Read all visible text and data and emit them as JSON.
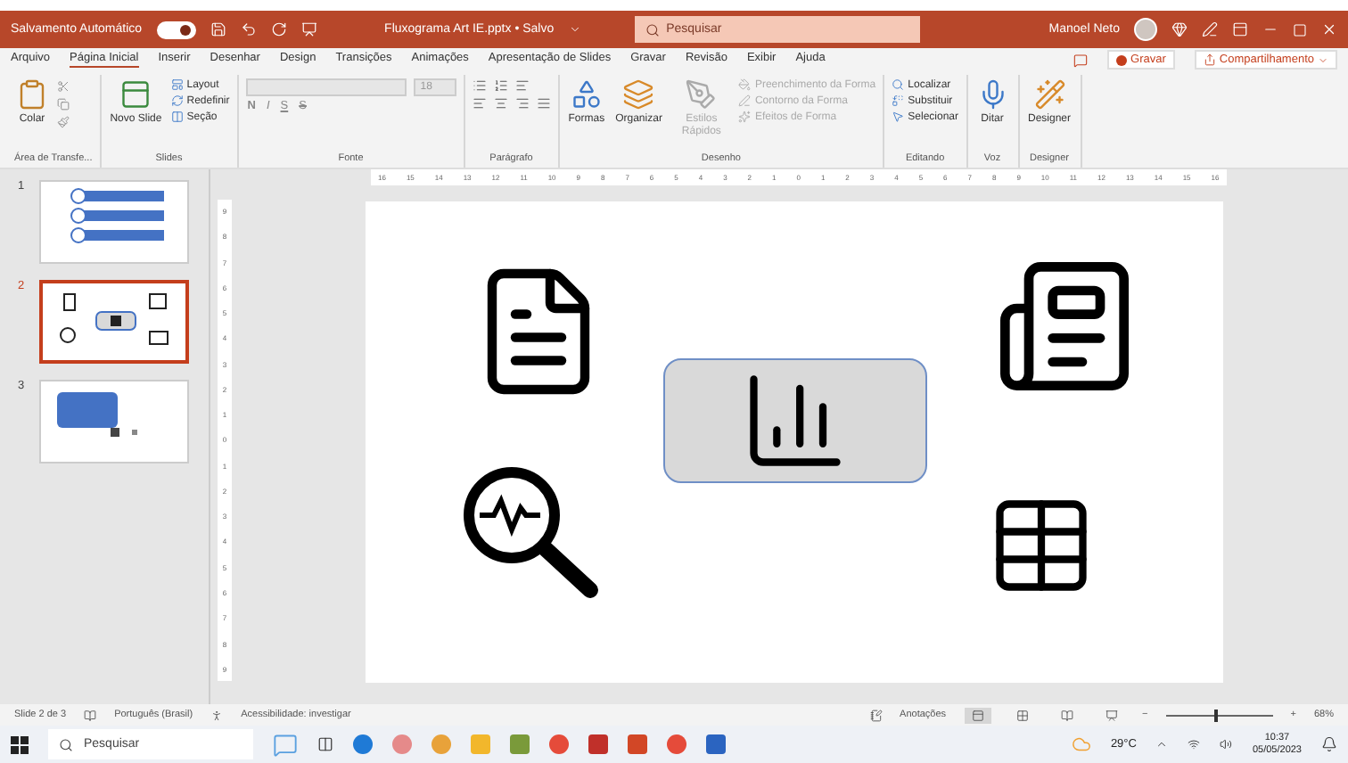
{
  "title_bar": {
    "autosave_label": "Salvamento Automático",
    "autosave_on": true,
    "file_title": "Fluxograma Art IE.pptx • Salvo",
    "search_placeholder": "Pesquisar",
    "user_name": "Manoel Neto"
  },
  "menu_tabs": [
    {
      "label": "Arquivo",
      "selected": false
    },
    {
      "label": "Página Inicial",
      "selected": true
    },
    {
      "label": "Inserir",
      "selected": false
    },
    {
      "label": "Desenhar",
      "selected": false
    },
    {
      "label": "Design",
      "selected": false
    },
    {
      "label": "Transições",
      "selected": false
    },
    {
      "label": "Animações",
      "selected": false
    },
    {
      "label": "Apresentação de Slides",
      "selected": false
    },
    {
      "label": "Gravar",
      "selected": false
    },
    {
      "label": "Revisão",
      "selected": false
    },
    {
      "label": "Exibir",
      "selected": false
    },
    {
      "label": "Ajuda",
      "selected": false
    }
  ],
  "record_button": "Gravar",
  "share_button": "Compartilhamento",
  "ribbon_groups": [
    {
      "title": "Área de Transfe...",
      "items": [
        {
          "kind": "big",
          "label": "Colar",
          "disabled": false
        },
        {
          "kind": "icons"
        }
      ]
    },
    {
      "title": "Slides",
      "items": [
        {
          "kind": "big",
          "label": "Novo Slide",
          "disabled": false
        },
        {
          "kind": "small",
          "labels": [
            "Layout",
            "Redefinir",
            "Seção"
          ],
          "disabled": false
        }
      ]
    },
    {
      "title": "Fonte",
      "items": [
        {
          "kind": "font",
          "size": "18",
          "format_buttons": [
            "N",
            "I",
            "S",
            "S"
          ]
        }
      ]
    },
    {
      "title": "Parágrafo",
      "items": [
        {
          "kind": "paragraph"
        }
      ]
    },
    {
      "title": "Desenho",
      "items": [
        {
          "kind": "big",
          "label": "Formas",
          "disabled": false
        },
        {
          "kind": "big",
          "label": "Organizar",
          "disabled": false
        },
        {
          "kind": "big",
          "label": "Estilos Rápidos",
          "disabled": true
        },
        {
          "kind": "small",
          "labels": [
            "Preenchimento da Forma",
            "Contorno da Forma",
            "Efeitos de Forma"
          ],
          "disabled": true
        }
      ]
    },
    {
      "title": "Editando",
      "items": [
        {
          "kind": "small",
          "labels": [
            "Localizar",
            "Substituir",
            "Selecionar"
          ],
          "disabled": false
        }
      ]
    },
    {
      "title": "Voz",
      "items": [
        {
          "kind": "big",
          "label": "Ditar",
          "disabled": false
        }
      ]
    },
    {
      "title": "Designer",
      "items": [
        {
          "kind": "big",
          "label": "Designer",
          "disabled": false
        }
      ]
    }
  ],
  "horizontal_ruler": [
    "16",
    "15",
    "14",
    "13",
    "12",
    "11",
    "10",
    "9",
    "8",
    "7",
    "6",
    "5",
    "4",
    "3",
    "2",
    "1",
    "0",
    "1",
    "2",
    "3",
    "4",
    "5",
    "6",
    "7",
    "8",
    "9",
    "10",
    "11",
    "12",
    "13",
    "14",
    "15",
    "16"
  ],
  "vertical_ruler": [
    "9",
    "8",
    "7",
    "6",
    "5",
    "4",
    "3",
    "2",
    "1",
    "0",
    "1",
    "2",
    "3",
    "4",
    "5",
    "6",
    "7",
    "8",
    "9"
  ],
  "thumbnails": [
    {
      "number": "1",
      "selected": false,
      "kind": "list"
    },
    {
      "number": "2",
      "selected": true,
      "kind": "icons"
    },
    {
      "number": "3",
      "selected": false,
      "kind": "shape"
    }
  ],
  "status_bar": {
    "slide_info": "Slide 2 de 3",
    "language": "Português (Brasil)",
    "accessibility": "Acessibilidade: investigar",
    "notes": "Anotações",
    "zoom_out": "−",
    "zoom_in": "+",
    "zoom": {
      "level": 0.45
    },
    "zoom_text": "68%"
  },
  "taskbar": {
    "search_placeholder": "Pesquisar",
    "temperature": "29°C",
    "time": "10:37",
    "date": "05/05/2023"
  }
}
